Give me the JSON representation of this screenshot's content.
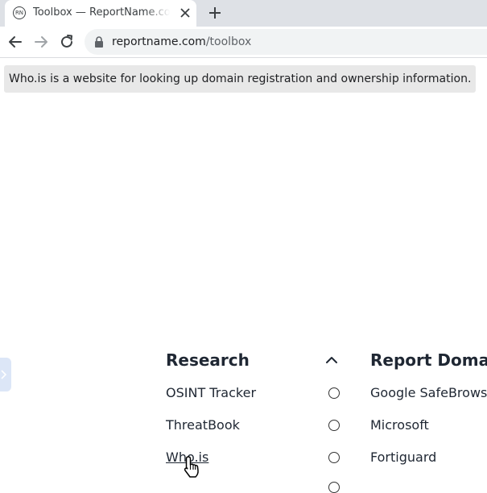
{
  "browser": {
    "tab": {
      "favicon_text": "RN",
      "title": "Toolbox — ReportName.com"
    },
    "url": {
      "host": "reportname.com",
      "path": "/toolbox"
    }
  },
  "page": {
    "tooltip_text": "Who.is is a website for looking up domain registration and ownership information.",
    "research": {
      "heading": "Research",
      "items": [
        "OSINT Tracker",
        "ThreatBook",
        "Who.is"
      ]
    },
    "report_domain": {
      "heading": "Report Doma",
      "options": [
        "Google SafeBrows",
        "Microsoft",
        "Fortiguard"
      ]
    }
  }
}
